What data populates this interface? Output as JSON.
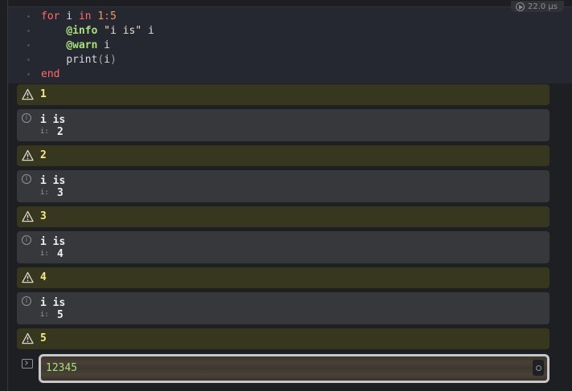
{
  "cell": {
    "runtime": "22.0 μs",
    "code_lines": [
      {
        "tokens": [
          {
            "t": "for",
            "c": "kw"
          },
          {
            "t": " ",
            "c": "ident"
          },
          {
            "t": "i",
            "c": "ident"
          },
          {
            "t": " ",
            "c": "ident"
          },
          {
            "t": "in",
            "c": "kw"
          },
          {
            "t": " ",
            "c": "ident"
          },
          {
            "t": "1",
            "c": "num"
          },
          {
            "t": ":",
            "c": "kw"
          },
          {
            "t": "5",
            "c": "num"
          }
        ]
      },
      {
        "tokens": [
          {
            "t": "    ",
            "c": "ident"
          },
          {
            "t": "@info",
            "c": "mac"
          },
          {
            "t": " ",
            "c": "ident"
          },
          {
            "t": "\"i is\"",
            "c": "str"
          },
          {
            "t": " i",
            "c": "ident"
          }
        ]
      },
      {
        "tokens": [
          {
            "t": "    ",
            "c": "ident"
          },
          {
            "t": "@warn",
            "c": "mac"
          },
          {
            "t": " i",
            "c": "ident"
          }
        ]
      },
      {
        "tokens": [
          {
            "t": "    ",
            "c": "ident"
          },
          {
            "t": "print",
            "c": "ident"
          },
          {
            "t": "(",
            "c": "paren"
          },
          {
            "t": "i",
            "c": "ident"
          },
          {
            "t": ")",
            "c": "paren"
          }
        ]
      },
      {
        "tokens": [
          {
            "t": "end",
            "c": "kw"
          }
        ]
      }
    ]
  },
  "logs": [
    {
      "level": "warn",
      "text": "1"
    },
    {
      "level": "info",
      "text": "i is",
      "key": "i:",
      "value": "2"
    },
    {
      "level": "warn",
      "text": "2"
    },
    {
      "level": "info",
      "text": "i is",
      "key": "i:",
      "value": "3"
    },
    {
      "level": "warn",
      "text": "3"
    },
    {
      "level": "info",
      "text": "i is",
      "key": "i:",
      "value": "4"
    },
    {
      "level": "warn",
      "text": "4"
    },
    {
      "level": "info",
      "text": "i is",
      "key": "i:",
      "value": "5"
    },
    {
      "level": "warn",
      "text": "5"
    }
  ],
  "stdout": {
    "text": "12345"
  },
  "colors": {
    "warn_bg": "#37361f",
    "warn_text": "#f4ea8a",
    "info_bg": "#37383c",
    "stdout_text": "#a9e07a"
  }
}
